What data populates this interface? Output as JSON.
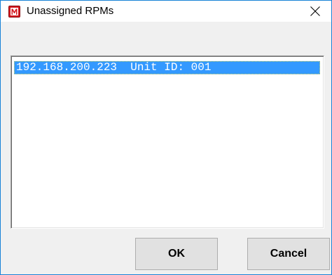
{
  "window": {
    "title": "Unassigned RPMs",
    "app_icon": "red-m-app-icon",
    "close_icon": "close-icon",
    "accent_color": "#1883d7"
  },
  "list": {
    "items": [
      {
        "text": "192.168.200.223  Unit ID: 001",
        "selected": true
      }
    ],
    "selection_color": "#3399ff"
  },
  "buttons": {
    "ok_label": "OK",
    "cancel_label": "Cancel"
  }
}
